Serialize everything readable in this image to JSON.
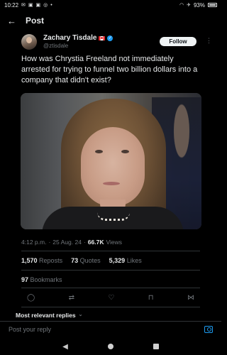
{
  "status": {
    "time": "10:22",
    "battery": "93%",
    "icons_left": [
      "chat-icon",
      "notification-icon",
      "app-icon",
      "app-icon",
      "messenger-icon",
      "dot-icon"
    ],
    "icons_right": [
      "wifi-icon",
      "airplane-icon",
      "battery-icon"
    ]
  },
  "header": {
    "back_icon": "←",
    "title": "Post"
  },
  "tweet": {
    "author_name": "Zachary Tisdale",
    "author_handle": "@ztisdale",
    "follow_label": "Follow",
    "more_icon": "⋮",
    "text": "How was Chrystia Freeland not immediately arrested for trying to funnel two billion dollars into a company that didn't exist?",
    "time": "4:12 p.m.",
    "sep1": "·",
    "date": "25 Aug. 24",
    "sep2": "·",
    "views_count": "66.7K",
    "views_label": "Views",
    "reposts_count": "1,570",
    "reposts_label": "Reposts",
    "quotes_count": "73",
    "quotes_label": "Quotes",
    "likes_count": "5,329",
    "likes_label": "Likes",
    "bookmarks_count": "97",
    "bookmarks_label": "Bookmarks"
  },
  "replies": {
    "sort_label": "Most relevant replies",
    "sort_chevron": "⌄"
  },
  "reply_bar": {
    "placeholder": "Post your reply"
  },
  "colors": {
    "background": "#000000",
    "accent": "#1d9bf0",
    "text": "#e7e9ea",
    "muted": "#71767b"
  }
}
